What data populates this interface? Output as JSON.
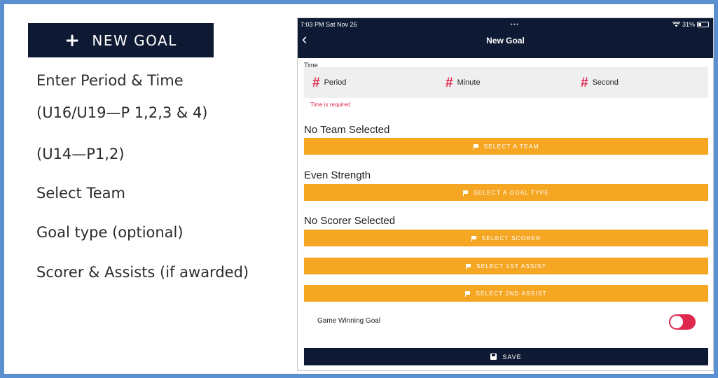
{
  "left_panel": {
    "new_goal_button": {
      "icon": "plus-icon",
      "label": "NEW GOAL"
    },
    "instructions": [
      "Enter Period & Time",
      "(U16/U19—P 1,2,3 & 4)",
      "(U14—P1,2)",
      "Select Team",
      "Goal type (optional)",
      "Scorer & Assists (if awarded)"
    ]
  },
  "device": {
    "status_bar": {
      "time": "7:03 PM  Sat Nov 26",
      "dots": "•••",
      "battery": "31%"
    },
    "nav": {
      "back_icon": "chevron-left-icon",
      "title": "New Goal"
    },
    "time_section": {
      "label": "Time",
      "fields": [
        "Period",
        "Minute",
        "Second"
      ],
      "error": "Time is required"
    },
    "team_section": {
      "title": "No Team Selected",
      "button": "SELECT A TEAM"
    },
    "goal_type_section": {
      "title": "Even Strength",
      "button": "SELECT A GOAL TYPE"
    },
    "scorer_section": {
      "title": "No Scorer Selected",
      "buttons": [
        "SELECT SCORER",
        "SELECT 1ST ASSIST",
        "SELECT 2ND ASSIST"
      ]
    },
    "game_winning_goal": {
      "label": "Game Winning Goal",
      "toggle_on": false
    },
    "save_button": "SAVE"
  },
  "colors": {
    "navy": "#0e1a33",
    "orange": "#f5a623",
    "red": "#e0284f",
    "frame_blue": "#5b8fd0"
  }
}
